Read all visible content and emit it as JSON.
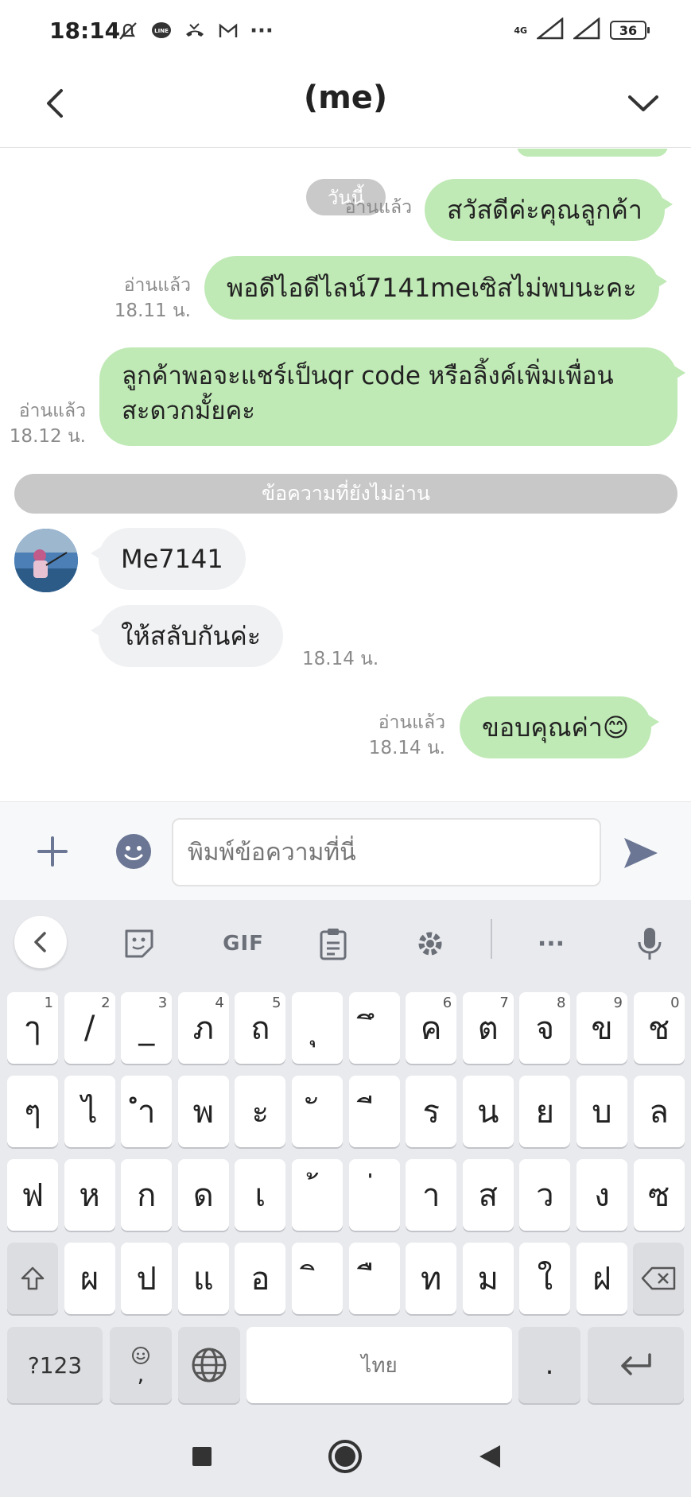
{
  "status_bar": {
    "time": "18:14",
    "network": "4G",
    "battery": "36",
    "more": "···"
  },
  "header": {
    "title": "(me)"
  },
  "chat": {
    "date_pill": "วันนี้",
    "messages": [
      {
        "side": "me",
        "text": "สวัสดีค่ะคุณลูกค้า",
        "read": "อ่านแล้ว",
        "time": ""
      },
      {
        "side": "me",
        "text": "พอดีไอดีไลน์7141meเซิสไม่พบนะคะ",
        "read": "อ่านแล้ว",
        "time": "18.11 น."
      },
      {
        "side": "me",
        "text_line1": "ลูกค้าพอจะแชร์เป็นqr code หรือลิ้งค์เพิ่มเพื่อน",
        "text_line2": "สะดวกมั้ยคะ",
        "read": "อ่านแล้ว",
        "time": "18.12 น."
      },
      {
        "side": "them",
        "text": "Me7141"
      },
      {
        "side": "them",
        "text": "ให้สลับกันค่ะ",
        "time": "18.14 น."
      },
      {
        "side": "me",
        "text": "ขอบคุณค่า😊",
        "read": "อ่านแล้ว",
        "time": "18.14 น."
      }
    ],
    "unread_divider": "ข้อความที่ยังไม่อ่าน"
  },
  "input_bar": {
    "placeholder": "พิมพ์ข้อความที่นี่"
  },
  "keyboard": {
    "toolbar": {
      "gif": "GIF",
      "more": "···"
    },
    "row1": [
      {
        "k": "ๅ",
        "h": "1"
      },
      {
        "k": "/",
        "h": "2"
      },
      {
        "k": "_",
        "h": "3"
      },
      {
        "k": "ภ",
        "h": "4"
      },
      {
        "k": "ถ",
        "h": "5"
      },
      {
        "k": "ุ",
        "h": ""
      },
      {
        "k": "ึ",
        "h": ""
      },
      {
        "k": "ค",
        "h": "6"
      },
      {
        "k": "ต",
        "h": "7"
      },
      {
        "k": "จ",
        "h": "8"
      },
      {
        "k": "ข",
        "h": "9"
      },
      {
        "k": "ช",
        "h": "0"
      }
    ],
    "row2": [
      "ๆ",
      "ไ",
      "ำ",
      "พ",
      "ะ",
      "ั",
      "ี",
      "ร",
      "น",
      "ย",
      "บ",
      "ล"
    ],
    "row3": [
      "ฟ",
      "ห",
      "ก",
      "ด",
      "เ",
      "้",
      "่",
      "า",
      "ส",
      "ว",
      "ง",
      "ซ"
    ],
    "row4": [
      "ผ",
      "ป",
      "แ",
      "อ",
      "ิ",
      "ื",
      "ท",
      "ม",
      "ใ",
      "ฝ"
    ],
    "bottom": {
      "sym": "?123",
      "emoji_comma": ",",
      "space": "ไทย",
      "period": "."
    }
  },
  "colors": {
    "bubble_me": "#bfe9b5",
    "bubble_them": "#f0f1f3",
    "icon_gray": "#6b6f78",
    "send_blue": "#6a7693"
  }
}
